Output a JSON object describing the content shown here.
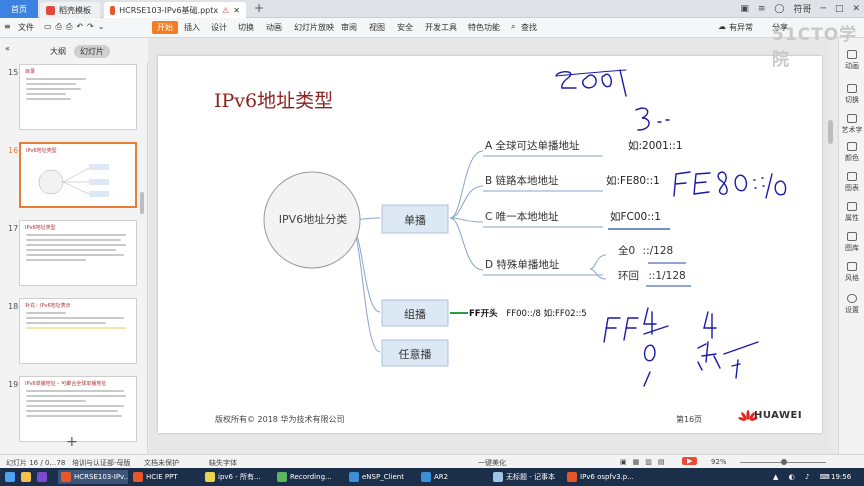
{
  "tabs": {
    "home": "首页",
    "template": "稻壳模板",
    "doc": "HCRSE103-IPv6基础.pptx",
    "user": "符哥"
  },
  "toolbar": {
    "file": "文件",
    "menus": [
      "开始",
      "插入",
      "设计",
      "切换",
      "动画",
      "幻灯片放映",
      "审阅",
      "视图",
      "安全",
      "开发工具",
      "特色功能"
    ],
    "search": "查找",
    "collab": "有异常",
    "share": "分享"
  },
  "sidebar": {
    "outline_tab": "大纲",
    "slides_tab": "幻灯片",
    "slides": [
      {
        "num": "15",
        "title": "目录"
      },
      {
        "num": "16",
        "title": "IPv6地址类型",
        "selected": true
      },
      {
        "num": "17",
        "title": "IPv6地址类型"
      },
      {
        "num": "18",
        "title": "补充：IPv6地址表示"
      },
      {
        "num": "19",
        "title": "IPv6单播地址 – 可聚合全球单播地址"
      }
    ]
  },
  "slide": {
    "title": "IPv6地址类型",
    "root": "IPV6地址分类",
    "branches": [
      "单播",
      "组播",
      "任意播"
    ],
    "unicast": [
      {
        "label": "A 全球可达单播地址",
        "example": "如:2001::1"
      },
      {
        "label": "B 链路本地地址",
        "example": "如:FE80::1"
      },
      {
        "label": "C 唯一本地地址",
        "example": "如FC00::1"
      },
      {
        "label": "D 特殊单播地址",
        "example": ""
      }
    ],
    "special": [
      {
        "label": "全0",
        "value": "::/128"
      },
      {
        "label": "环回",
        "value": "::1/128"
      }
    ],
    "multicast_note_bold": "FF开头",
    "multicast_note_rest": "FF00::/8   如:FF02::5",
    "copyright": "版权所有© 2018 华为技术有限公司",
    "page": "第16页",
    "brand": "HUAWEI"
  },
  "handwriting": {
    "top": "2001",
    "three": "3::",
    "fe80": "FE80::/10",
    "ff": "FF",
    "digits": [
      "4",
      "4",
      "0"
    ],
    "chinese": "范1"
  },
  "right_panel": [
    "动画",
    "切换",
    "艺术字",
    "颜色",
    "图表",
    "属性",
    "图库",
    "风格",
    "设置"
  ],
  "status": {
    "slide": "幻灯片 16 / 0…78",
    "theme": "培训与认证部-母版",
    "protect": "文档未保护",
    "font": "缺失字体",
    "beautify": "一键美化",
    "zoom": "92%"
  },
  "taskbar": [
    "HCRSE103-IPv...",
    "HCIE PPT",
    "ipv6 - 所有...",
    "Recording...",
    "eNSP_Client",
    "AR2",
    "无标题 - 记事本",
    "IPv6 ospfv3.p..."
  ],
  "clock": "19:56",
  "watermark": "51CTO学院",
  "colors": {
    "accent": "#f47b20",
    "title": "#8b2323",
    "node_fill": "#dde8f5",
    "ink": "#1a1aa6",
    "underline": "#1f4aa8"
  }
}
